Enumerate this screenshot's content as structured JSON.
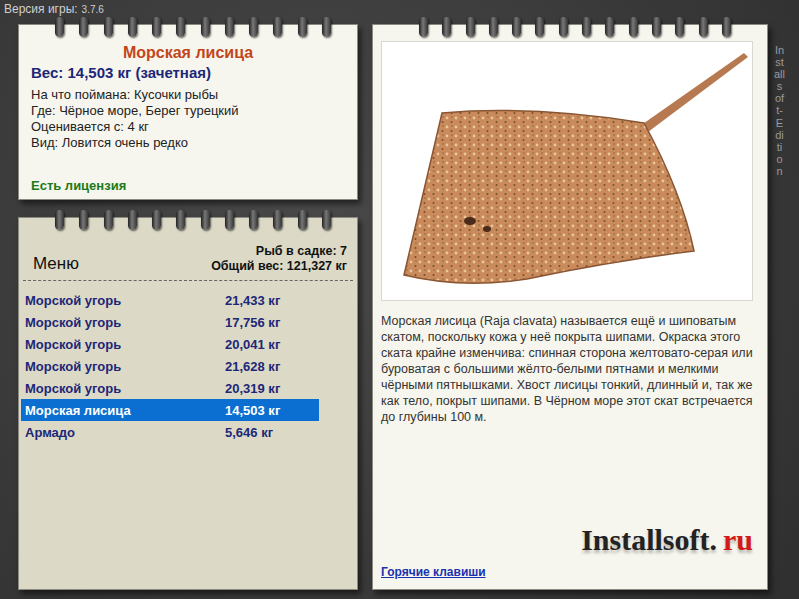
{
  "version": {
    "label": "Версия игры:",
    "value": "3.7.6"
  },
  "fish_card": {
    "title": "Морская лисица",
    "weight": "Вес: 14,503 кг (зачетная)",
    "details": [
      "На что поймана: Кусочки рыбы",
      "Где: Чёрное море, Берег турецкий",
      "Оценивается с: 4 кг",
      "Вид: Ловится очень редко"
    ],
    "license": "Есть лицензия"
  },
  "keepnet": {
    "menu": "Меню",
    "count": "Рыб в садке: 7",
    "total": "Общий вес: 121,327 кг",
    "rows": [
      {
        "name": "Морской угорь",
        "weight": "21,433 кг",
        "selected": false
      },
      {
        "name": "Морской угорь",
        "weight": "17,756 кг",
        "selected": false
      },
      {
        "name": "Морской угорь",
        "weight": "20,041 кг",
        "selected": false
      },
      {
        "name": "Морской угорь",
        "weight": "21,628 кг",
        "selected": false
      },
      {
        "name": "Морской угорь",
        "weight": "20,319 кг",
        "selected": false
      },
      {
        "name": "Морская лисица",
        "weight": "14,503 кг",
        "selected": true
      },
      {
        "name": "Армадо",
        "weight": "5,646 кг",
        "selected": false
      }
    ]
  },
  "info": {
    "description": "Морская лисица (Raja clavata) называется ещё и шиповатым скатом, поскольку кожа у неё покрыта шипами. Окраска этого ската крайне изменчива: спинная сторона желтовато-серая или буроватая с большими жёлто-белыми пятнами и мелкими чёрными пятнышками. Хвост лисицы тонкий, длинный и, так же как тело, покрыт шипами. В Чёрном море этот скат встречается до глубины 100 м.",
    "hotkeys": "Горячие клавиши",
    "logo": {
      "name": "Installsoft.",
      "tld": "ru"
    },
    "watermark": "Installsoft-Edition"
  }
}
